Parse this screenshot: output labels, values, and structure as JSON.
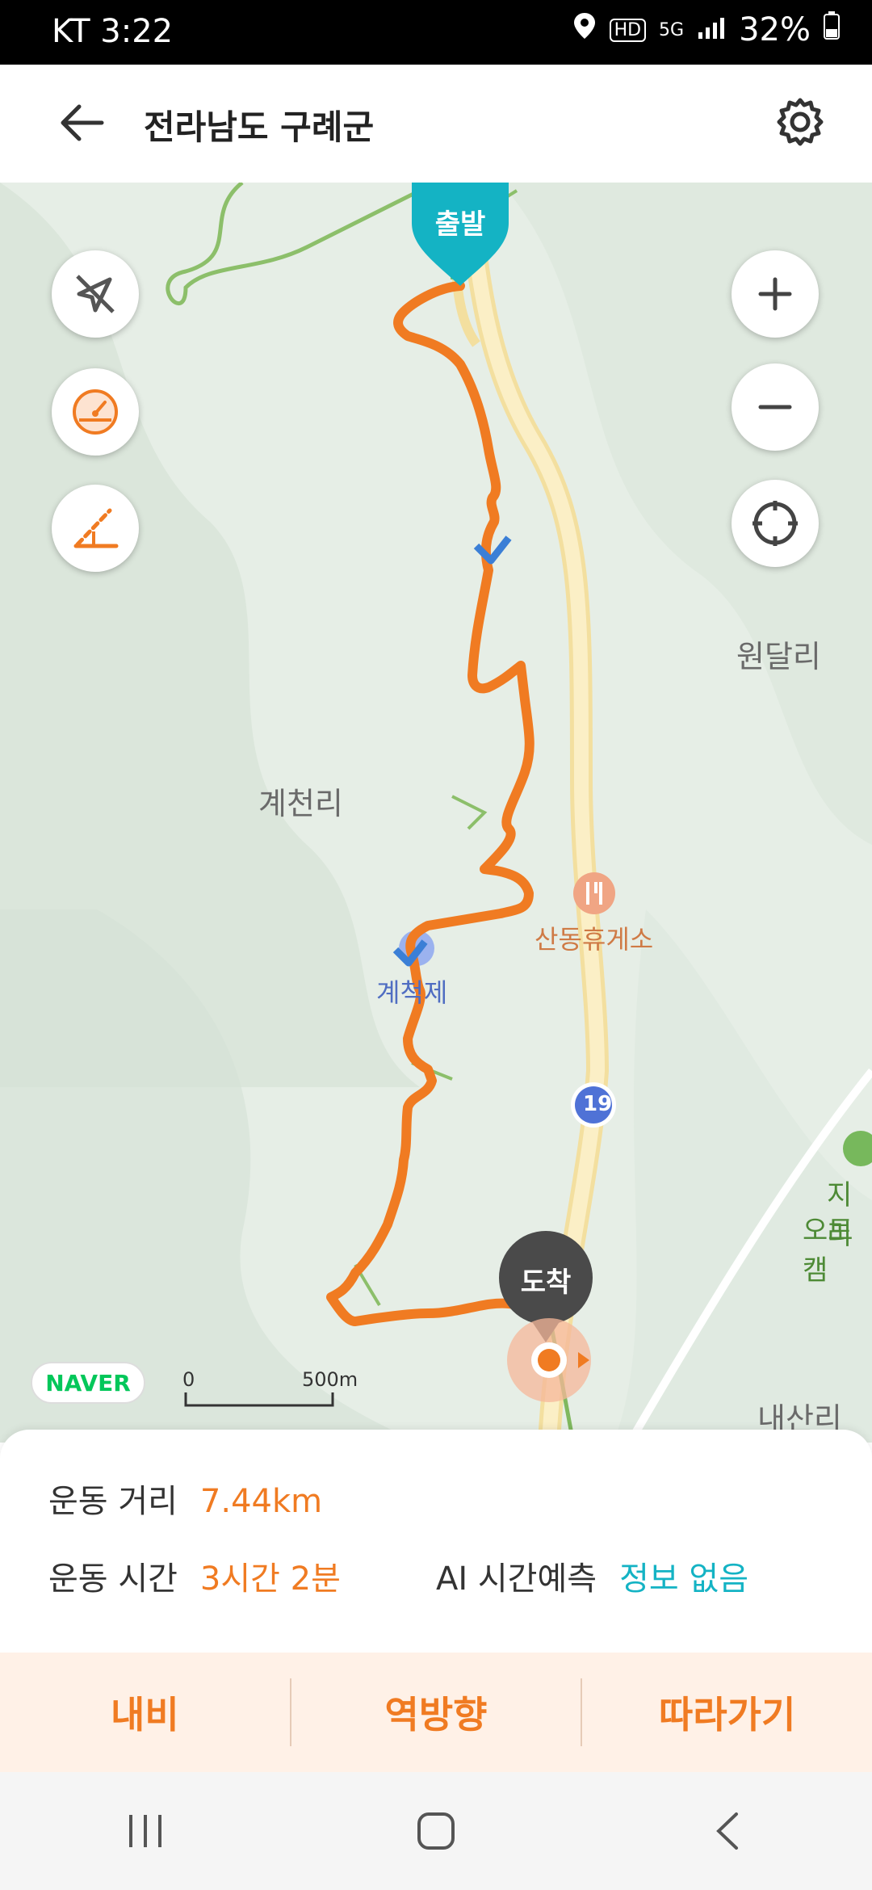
{
  "status": {
    "carrier_time": "KT 3:22",
    "battery": "32%"
  },
  "header": {
    "title": "전라남도 구례군"
  },
  "map": {
    "labels": {
      "wondal": "원달리",
      "gyecheon": "계천리",
      "sandong": "산동휴게소",
      "dam": "계척제",
      "jiri": "지리",
      "oto": "오토캠",
      "naesan": "내산리"
    },
    "start_label": "출발",
    "end_label": "도착",
    "road_number": "19",
    "naver": "NAVER",
    "scale_start": "0",
    "scale_end": "500m"
  },
  "stats": {
    "distance_label": "운동 거리",
    "distance_value": "7.44km",
    "time_label": "운동 시간",
    "time_value": "3시간 2분",
    "ai_label": "AI 시간예측",
    "ai_value": "정보 없음"
  },
  "actions": {
    "nav": "내비",
    "reverse": "역방향",
    "follow": "따라가기"
  },
  "colors": {
    "route": "#f07b22",
    "start_pin": "#14b3c4",
    "end_pin": "#4a4a4a"
  }
}
